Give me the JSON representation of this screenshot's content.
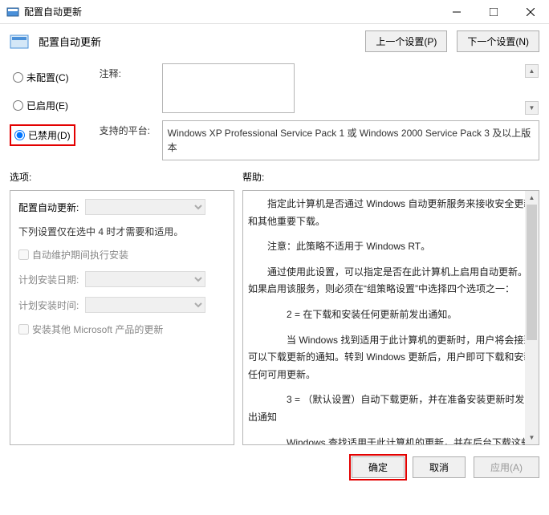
{
  "titlebar": {
    "title": "配置自动更新"
  },
  "header": {
    "title": "配置自动更新",
    "prev_btn": "上一个设置(P)",
    "next_btn": "下一个设置(N)"
  },
  "radios": {
    "not_configured": "未配置(C)",
    "enabled": "已启用(E)",
    "disabled": "已禁用(D)"
  },
  "fields": {
    "comment_label": "注释:",
    "platform_label": "支持的平台:",
    "platform_text": "Windows XP Professional Service Pack 1 或 Windows 2000 Service Pack 3 及以上版本"
  },
  "labels": {
    "options": "选项:",
    "help": "帮助:"
  },
  "options": {
    "section1": "配置自动更新:",
    "note": "下列设置仅在选中 4 时才需要和适用。",
    "cb_maintenance": "自动维护期间执行安装",
    "install_date": "计划安装日期:",
    "install_time": "计划安装时间:",
    "cb_other_ms": "安装其他 Microsoft 产品的更新"
  },
  "help": {
    "p1": "指定此计算机是否通过 Windows 自动更新服务来接收安全更新和其他重要下载。",
    "p2": "注意：此策略不适用于 Windows RT。",
    "p3": "通过使用此设置，可以指定是否在此计算机上启用自动更新。如果启用该服务，则必须在“组策略设置”中选择四个选项之一：",
    "p4": "2 = 在下载和安装任何更新前发出通知。",
    "p5": "当 Windows 找到适用于此计算机的更新时，用户将会接到可以下载更新的通知。转到 Windows 更新后，用户即可下载和安装任何可用更新。",
    "p6": "3 = （默认设置）自动下载更新，并在准备安装更新时发出通知",
    "p7": "Windows 查找适用于此计算机的更新，并在后台下载这些更新（在此过程中，用户不会收到通知或被打断工作）。完成下载后，用户将收到可以安装更新的通知。转到 Windows 更新后，用户即可安装更新。"
  },
  "footer": {
    "ok": "确定",
    "cancel": "取消",
    "apply": "应用(A)"
  }
}
